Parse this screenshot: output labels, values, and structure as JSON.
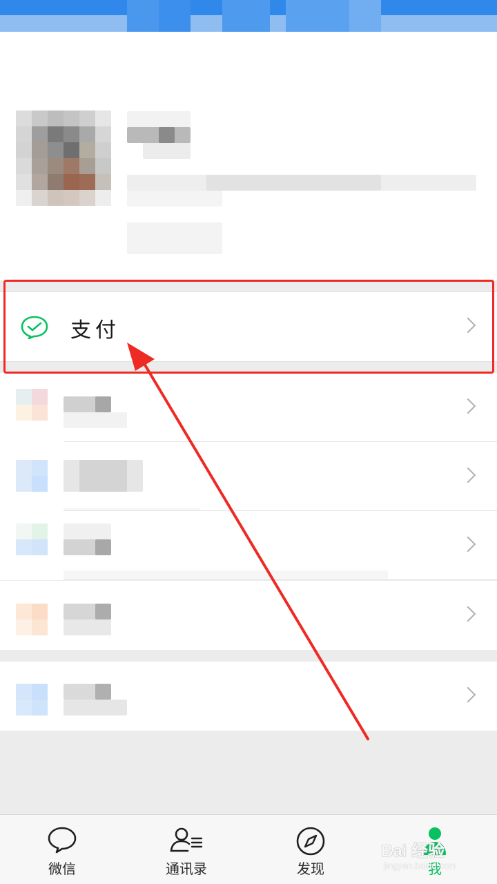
{
  "menu": {
    "pay_label": "支付"
  },
  "tabbar": {
    "tabs": [
      {
        "label": "微信",
        "icon": "chat-bubble-icon"
      },
      {
        "label": "通讯录",
        "icon": "contacts-icon"
      },
      {
        "label": "发现",
        "icon": "compass-icon"
      },
      {
        "label": "我",
        "icon": "person-icon",
        "active": true
      }
    ]
  },
  "watermark": {
    "main": "Bai 经验",
    "sub": "jingyan.baidu.com"
  },
  "colors": {
    "wechat_green": "#07c160",
    "highlight_red": "#ee2a24",
    "status_blue": "#2f88ea"
  }
}
